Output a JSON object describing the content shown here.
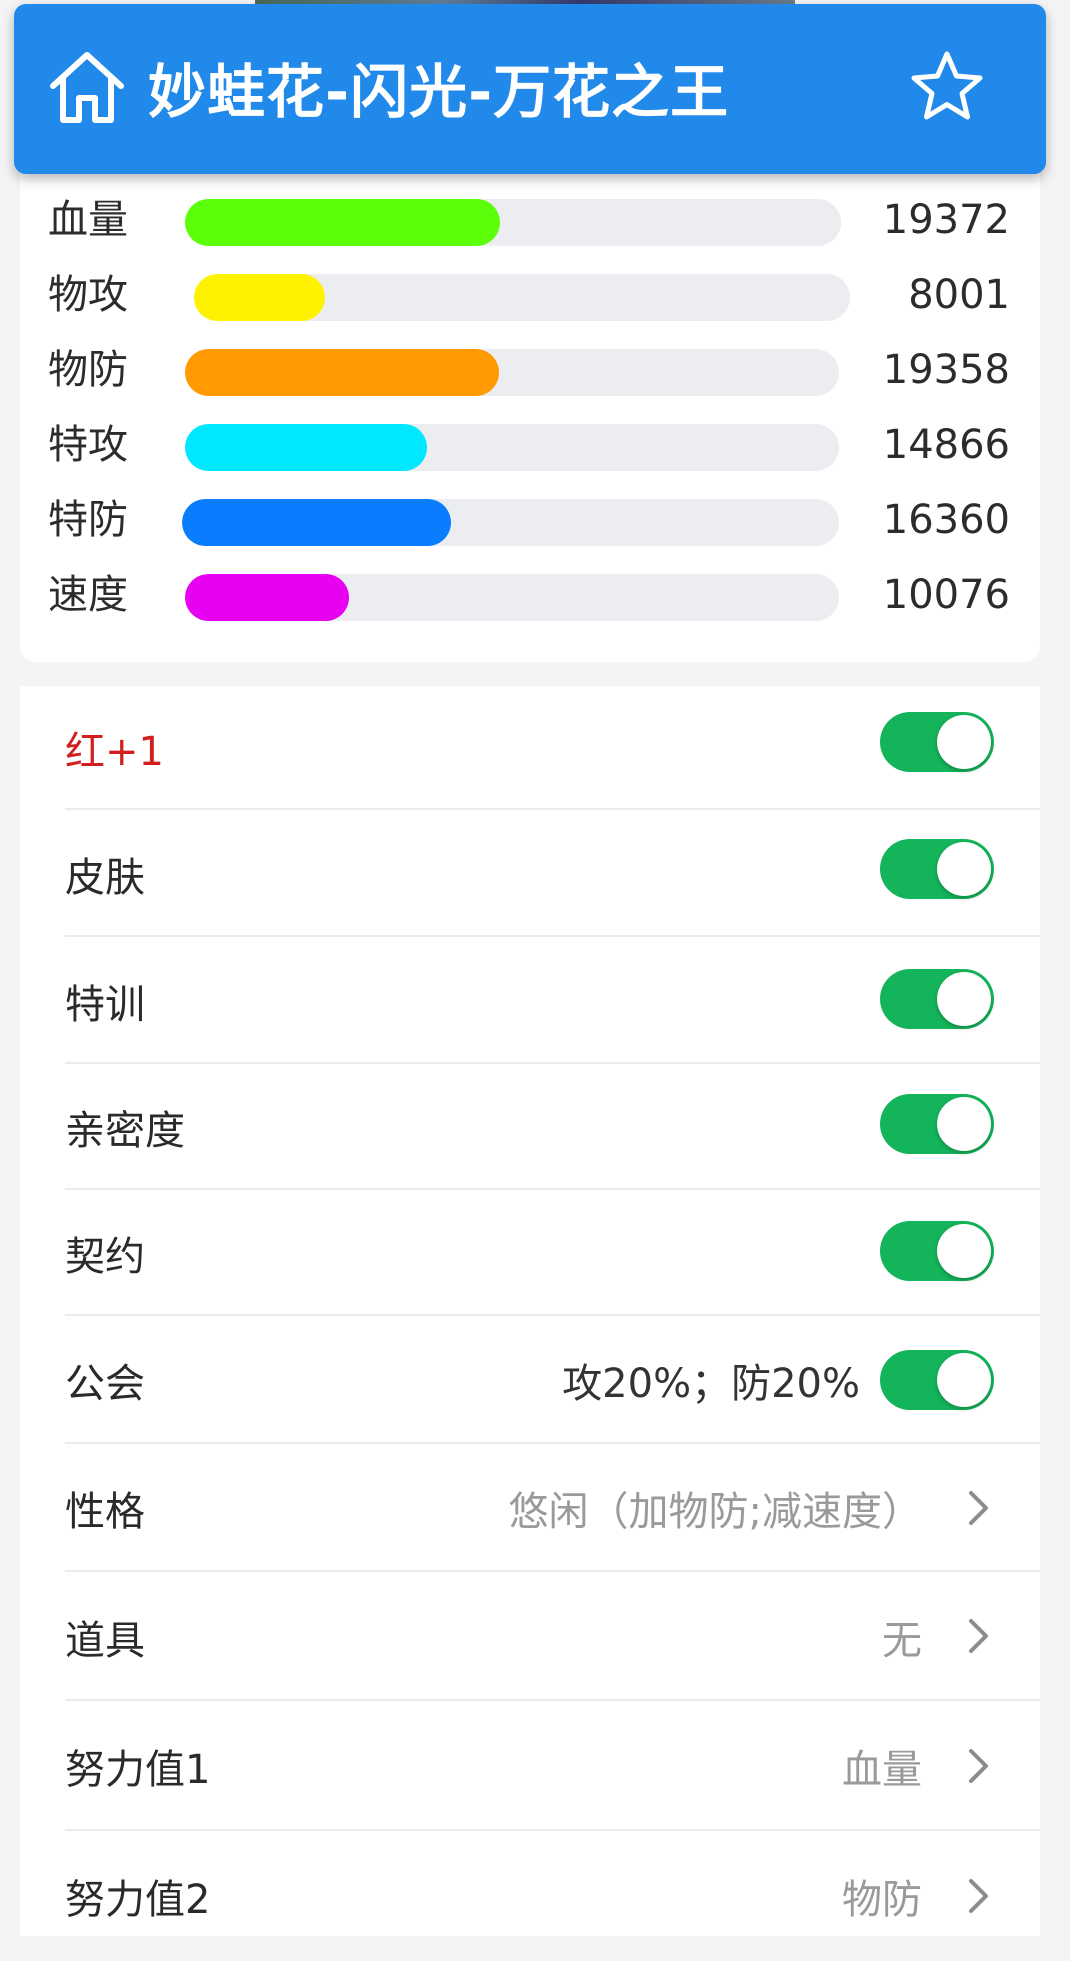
{
  "header": {
    "title": "妙蛙花-闪光-万花之王",
    "home_icon": "home-icon",
    "favorite_icon": "star-icon"
  },
  "stats": [
    {
      "label": "血量",
      "value": "19372",
      "fill": 0.48,
      "color": "#5cff0a"
    },
    {
      "label": "物攻",
      "value": "8001",
      "fill": 0.2,
      "color": "#fff200"
    },
    {
      "label": "物防",
      "value": "19358",
      "fill": 0.48,
      "color": "#ff9a00"
    },
    {
      "label": "特攻",
      "value": "14866",
      "fill": 0.37,
      "color": "#00e8ff"
    },
    {
      "label": "特防",
      "value": "16360",
      "fill": 0.41,
      "color": "#0a7dff"
    },
    {
      "label": "速度",
      "value": "10076",
      "fill": 0.25,
      "color": "#e800f0"
    }
  ],
  "settings": {
    "toggles": [
      {
        "label": "红+1",
        "on": true,
        "highlight": "#d21e1e"
      },
      {
        "label": "皮肤",
        "on": true
      },
      {
        "label": "特训",
        "on": true
      },
      {
        "label": "亲密度",
        "on": true
      },
      {
        "label": "契约",
        "on": true
      },
      {
        "label": "公会",
        "on": true,
        "extra": "攻20%；防20%"
      }
    ],
    "selects": [
      {
        "label": "性格",
        "value": "悠闲（加物防;减速度）"
      },
      {
        "label": "道具",
        "value": "无"
      },
      {
        "label": "努力值1",
        "value": "血量"
      },
      {
        "label": "努力值2",
        "value": "物防"
      }
    ],
    "toggle_color": "#14b45a"
  }
}
